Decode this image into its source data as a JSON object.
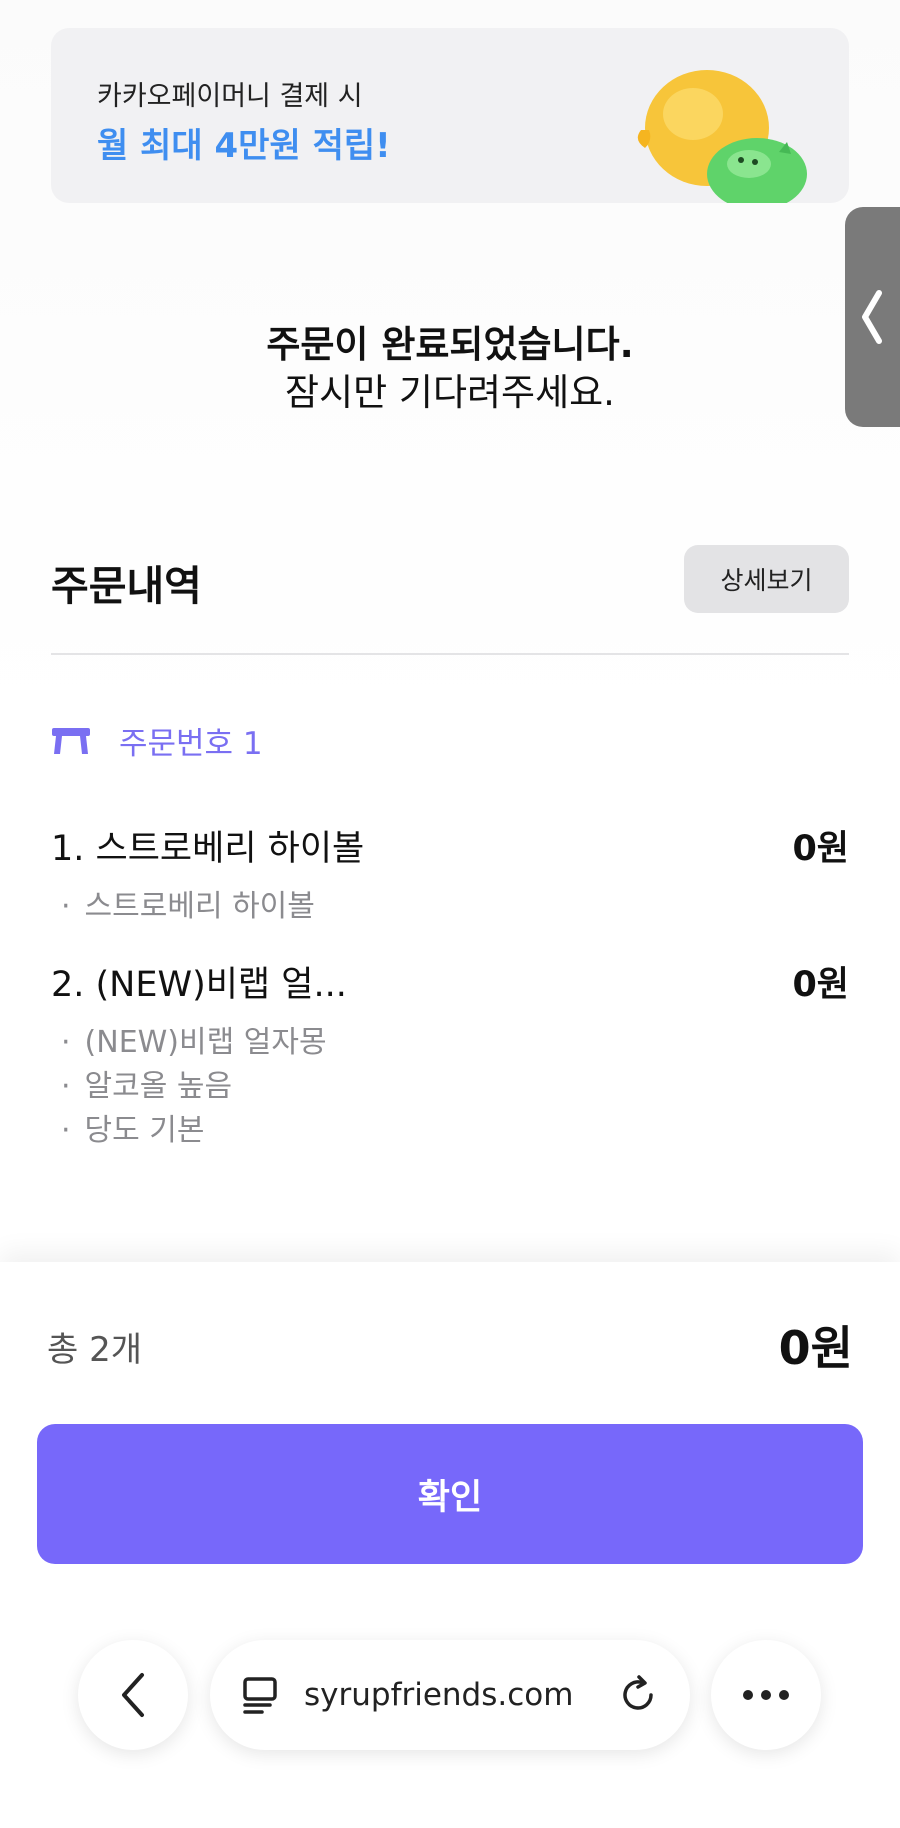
{
  "banner": {
    "sub_text": "카카오페이머니 결제 시",
    "main_text": "월 최대 4만원 적립!"
  },
  "completion": {
    "line1": "주문이 완료되었습니다.",
    "line2": "잠시만 기다려주세요."
  },
  "order": {
    "title": "주문내역",
    "detail_label": "상세보기",
    "order_number_label": "주문번호 1",
    "items": [
      {
        "name": "1. 스트로베리 하이볼",
        "price": "0원",
        "options": [
          "스트로베리 하이볼"
        ]
      },
      {
        "name": "2. (NEW)비랩 얼...",
        "price": "0원",
        "options": [
          "(NEW)비랩 얼자몽",
          "알코올 높음",
          "당도 기본"
        ]
      }
    ]
  },
  "summary": {
    "count_label": "총 2개",
    "total": "0원",
    "confirm_label": "확인"
  },
  "browser": {
    "url": "syrupfriends.com",
    "icons": [
      "back-icon",
      "tabs-icon",
      "reload-icon",
      "more-icon"
    ]
  },
  "colors": {
    "accent": "#7768fa",
    "order_number": "#7a6ff2",
    "banner_highlight": "#3f8ef0"
  }
}
